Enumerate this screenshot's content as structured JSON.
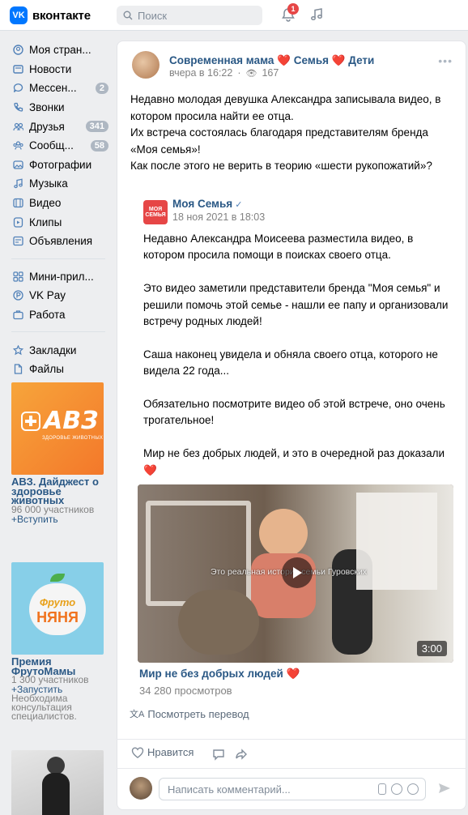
{
  "header": {
    "logo_text": "вконтакте",
    "logo_mark": "VK",
    "search_placeholder": "Поиск",
    "notifications_count": "1"
  },
  "sidebar": {
    "items": [
      {
        "label": "Моя стран...",
        "icon": "user-circle-icon"
      },
      {
        "label": "Новости",
        "icon": "news-icon"
      },
      {
        "label": "Мессен...",
        "icon": "message-icon",
        "count": "2"
      },
      {
        "label": "Звонки",
        "icon": "phone-icon"
      },
      {
        "label": "Друзья",
        "icon": "friends-icon",
        "count": "341"
      },
      {
        "label": "Сообщ...",
        "icon": "communities-icon",
        "count": "58"
      },
      {
        "label": "Фотографии",
        "icon": "photo-icon"
      },
      {
        "label": "Музыка",
        "icon": "music-icon"
      },
      {
        "label": "Видео",
        "icon": "video-icon"
      },
      {
        "label": "Клипы",
        "icon": "clips-icon"
      },
      {
        "label": "Объявления",
        "icon": "classifieds-icon"
      }
    ],
    "items2": [
      {
        "label": "Мини-прил...",
        "icon": "apps-icon"
      },
      {
        "label": "VK Pay",
        "icon": "vkpay-icon"
      },
      {
        "label": "Работа",
        "icon": "work-icon"
      }
    ],
    "items3": [
      {
        "label": "Закладки",
        "icon": "star-icon"
      },
      {
        "label": "Файлы",
        "icon": "file-icon"
      }
    ]
  },
  "ads": [
    {
      "logo_text": "АВЗ",
      "logo_sub": "ЗДОРОВЬЕ ЖИВОТНЫХ",
      "title": "АВЗ. Дайджест о здоровье животных",
      "meta": "96 000 участников",
      "link": "+Вступить"
    },
    {
      "logo_text": "Фруто",
      "logo_text2": "НЯНЯ",
      "title": "Премия ФрутоМамы",
      "meta": "1 300 участников",
      "link": "+Запустить",
      "note": "Необходима консультация специалистов."
    }
  ],
  "post": {
    "author": "Современная мама ❤️ Семья ❤️ Дети",
    "time": "вчера в 16:22",
    "views": "167",
    "text": [
      "Недавно молодая девушка Александра записывала видео, в котором просила найти ее отца.",
      "Их встреча состоялась благодаря представителям бренда «Моя семья»!",
      "Как после этого не верить в теорию «шести рукопожатий»?"
    ],
    "repost": {
      "logo_text": "МОЯ СЕМЬЯ",
      "author": "Моя Семья",
      "date": "18 ноя 2021 в 18:03",
      "paragraphs": [
        "Недавно Александра Моисеева разместила видео, в котором просила помощи в поисках своего отца.",
        "Это видео заметили представители бренда \"Моя семья\" и решили помочь этой семье - нашли ее папу и организовали встречу родных людей!",
        "Саша наконец увидела и обняла своего отца, которого не видела 22 года...",
        "Обязательно посмотрите видео об этой встрече, оно очень трогательное!",
        "Мир не без добрых людей, и это в очередной раз доказали ❤️"
      ]
    },
    "video": {
      "caption": "Это реальная история семьи Гуровских",
      "duration": "3:00",
      "title": "Мир не без добрых людей ❤️",
      "views": "34 280 просмотров"
    },
    "translate": "Посмотреть перевод",
    "like": "Нравится",
    "comment_placeholder": "Написать комментарий..."
  },
  "colors": {
    "accent": "#2a5885",
    "brand": "#0077ff",
    "icon": "#5181b8",
    "badge": "#e64646"
  }
}
